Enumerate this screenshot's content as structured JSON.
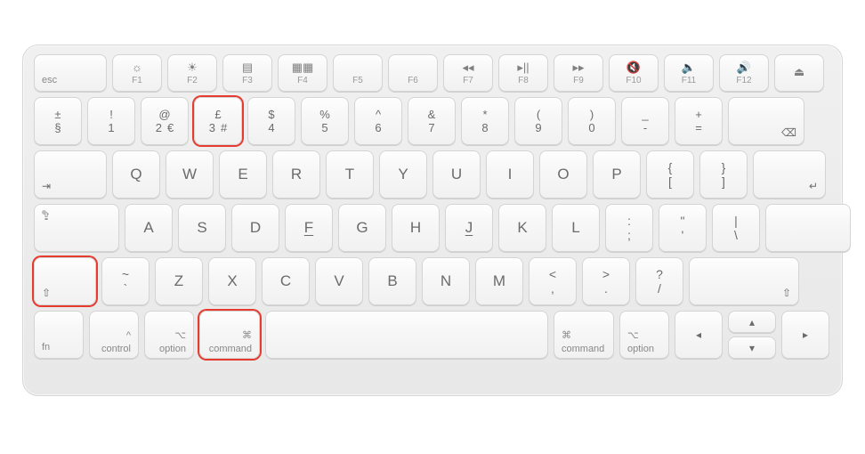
{
  "highlight_color": "#e63b2e",
  "fnRow": {
    "esc": "esc",
    "keys": [
      {
        "icon": "☼",
        "label": "F1"
      },
      {
        "icon": "☀",
        "label": "F2"
      },
      {
        "icon": "▤",
        "label": "F3"
      },
      {
        "icon": "▦▦",
        "label": "F4"
      },
      {
        "icon": "",
        "label": "F5"
      },
      {
        "icon": "",
        "label": "F6"
      },
      {
        "icon": "◂◂",
        "label": "F7"
      },
      {
        "icon": "▸||",
        "label": "F8"
      },
      {
        "icon": "▸▸",
        "label": "F9"
      },
      {
        "icon": "🔇",
        "label": "F10"
      },
      {
        "icon": "🔈",
        "label": "F11"
      },
      {
        "icon": "🔊",
        "label": "F12"
      }
    ],
    "eject": "⏏"
  },
  "numRow": {
    "left": {
      "top": "±",
      "bot": "§"
    },
    "keys": [
      {
        "top": "!",
        "bot": "1"
      },
      {
        "top": "@",
        "bot": "2",
        "extra": "€"
      },
      {
        "top": "£",
        "bot": "3",
        "extra": "#",
        "highlight": true
      },
      {
        "top": "$",
        "bot": "4"
      },
      {
        "top": "%",
        "bot": "5"
      },
      {
        "top": "^",
        "bot": "6"
      },
      {
        "top": "&",
        "bot": "7"
      },
      {
        "top": "*",
        "bot": "8"
      },
      {
        "top": "(",
        "bot": "9"
      },
      {
        "top": ")",
        "bot": "0"
      },
      {
        "top": "_",
        "bot": "-"
      },
      {
        "top": "+",
        "bot": "="
      }
    ],
    "backspace": "⌫"
  },
  "qRow": {
    "tab": "⇥",
    "letters": [
      "Q",
      "W",
      "E",
      "R",
      "T",
      "Y",
      "U",
      "I",
      "O",
      "P"
    ],
    "brackets": [
      {
        "top": "{",
        "bot": "["
      },
      {
        "top": "}",
        "bot": "]"
      }
    ],
    "enter": "↵"
  },
  "aRow": {
    "caps": "⇪",
    "letters": [
      "A",
      "S",
      "D",
      "F",
      "G",
      "H",
      "J",
      "K",
      "L"
    ],
    "right": [
      {
        "top": ":",
        "bot": ";"
      },
      {
        "top": "\"",
        "bot": "'"
      },
      {
        "top": "|",
        "bot": "\\"
      }
    ]
  },
  "zRow": {
    "shiftL": "⇧",
    "tilde": {
      "top": "~",
      "bot": "`"
    },
    "letters": [
      "Z",
      "X",
      "C",
      "V",
      "B",
      "N",
      "M"
    ],
    "right": [
      {
        "top": "<",
        "bot": ","
      },
      {
        "top": ">",
        "bot": "."
      },
      {
        "top": "?",
        "bot": "/"
      }
    ],
    "shiftR": "⇧"
  },
  "bottom": {
    "fn": "fn",
    "ctrl_sym": "^",
    "ctrl": "control",
    "opt_sym": "⌥",
    "opt": "option",
    "cmd_sym": "⌘",
    "cmd": "command",
    "arrows": {
      "l": "◂",
      "u": "▴",
      "d": "▾",
      "r": "▸"
    }
  }
}
